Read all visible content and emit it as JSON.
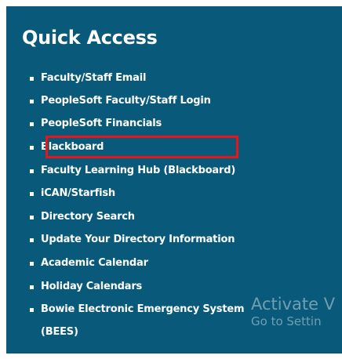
{
  "quick_access": {
    "title": "Quick Access",
    "links": [
      {
        "label": "Faculty/Staff Email"
      },
      {
        "label": "PeopleSoft Faculty/Staff Login"
      },
      {
        "label": "PeopleSoft Financials"
      },
      {
        "label": "Blackboard"
      },
      {
        "label": "Faculty Learning Hub (Blackboard)"
      },
      {
        "label": "iCAN/Starfish"
      },
      {
        "label": "Directory Search"
      },
      {
        "label": "Update Your Directory Information"
      },
      {
        "label": "Academic Calendar"
      },
      {
        "label": "Holiday Calendars"
      },
      {
        "label": "Bowie Electronic Emergency System"
      },
      {
        "label": "(BEES)"
      }
    ]
  },
  "watermark": {
    "line1": "Activate V",
    "line2": "Go to Settin"
  },
  "colors": {
    "panel_background": "#08597a",
    "text": "#ffffff",
    "highlight_border": "#e8151b"
  }
}
